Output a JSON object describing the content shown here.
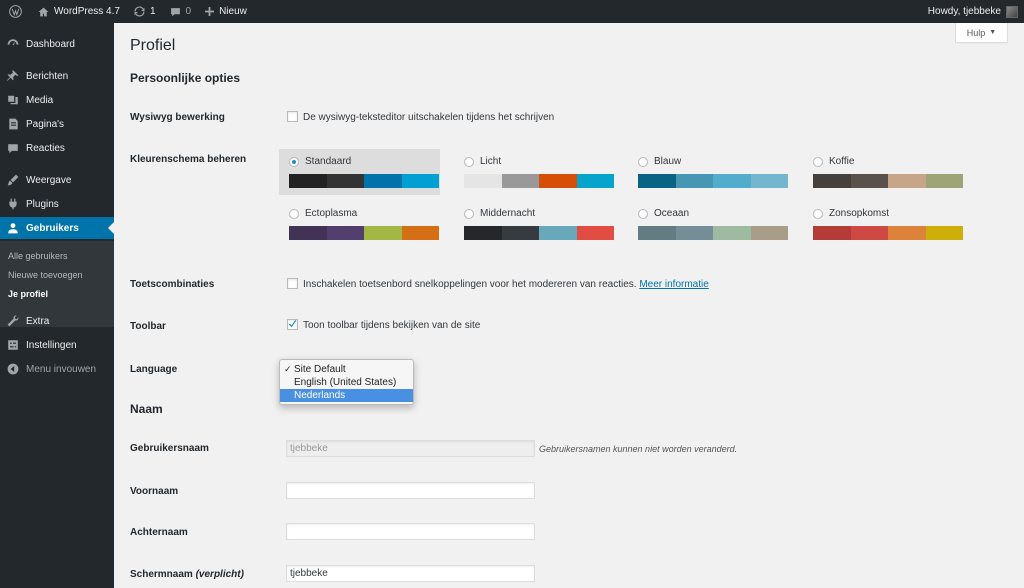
{
  "adminbar": {
    "site_name": "WordPress 4.7",
    "updates_count": "1",
    "comments_count": "0",
    "new_label": "Nieuw",
    "howdy": "Howdy, tjebbeke"
  },
  "sidebar": {
    "items": [
      {
        "label": "Dashboard",
        "icon": "dashboard-icon"
      },
      {
        "label": "Berichten",
        "icon": "pushpin-icon"
      },
      {
        "label": "Media",
        "icon": "media-icon"
      },
      {
        "label": "Pagina's",
        "icon": "page-icon"
      },
      {
        "label": "Reacties",
        "icon": "comment-icon"
      },
      {
        "label": "Weergave",
        "icon": "appearance-icon"
      },
      {
        "label": "Plugins",
        "icon": "plugin-icon"
      },
      {
        "label": "Gebruikers",
        "icon": "users-icon"
      },
      {
        "label": "Extra",
        "icon": "tools-icon"
      },
      {
        "label": "Instellingen",
        "icon": "settings-icon"
      }
    ],
    "submenu": [
      "Alle gebruikers",
      "Nieuwe toevoegen",
      "Je profiel"
    ],
    "collapse": "Menu invouwen"
  },
  "page": {
    "title": "Profiel",
    "help": "Hulp",
    "personal_options": "Persoonlijke opties",
    "wysiwyg_label": "Wysiwyg bewerking",
    "wysiwyg_text": "De wysiwyg-teksteditor uitschakelen tijdens het schrijven",
    "color_label": "Kleurenschema beheren",
    "shortcuts_label": "Toetscombinaties",
    "shortcuts_text": "Inschakelen toetsenbord snelkoppelingen voor het modereren van reacties.",
    "shortcuts_link": "Meer informatie",
    "toolbar_label": "Toolbar",
    "toolbar_text": "Toon toolbar tijdens bekijken van de site",
    "language_label": "Language",
    "name_section": "Naam",
    "username_label": "Gebruikersnaam",
    "username_value": "tjebbeke",
    "username_desc": "Gebruikersnamen kunnen niet worden veranderd.",
    "firstname_label": "Voornaam",
    "lastname_label": "Achternaam",
    "nickname_label": "Schermnaam",
    "nickname_required": "(verplicht)",
    "nickname_value": "tjebbeke"
  },
  "schemes": [
    {
      "name": "Standaard",
      "selected": true,
      "colors": [
        "#222222",
        "#333333",
        "#0073aa",
        "#00a0d2"
      ]
    },
    {
      "name": "Licht",
      "selected": false,
      "colors": [
        "#e5e5e5",
        "#999999",
        "#d64e07",
        "#04a4cc"
      ]
    },
    {
      "name": "Blauw",
      "selected": false,
      "colors": [
        "#096484",
        "#4796b3",
        "#52accc",
        "#74b6ce"
      ]
    },
    {
      "name": "Koffie",
      "selected": false,
      "colors": [
        "#46403c",
        "#59524c",
        "#c7a589",
        "#9ea476"
      ]
    },
    {
      "name": "Ectoplasma",
      "selected": false,
      "colors": [
        "#413256",
        "#523f6d",
        "#a3b745",
        "#d46f15"
      ]
    },
    {
      "name": "Middernacht",
      "selected": false,
      "colors": [
        "#25282b",
        "#363b3f",
        "#69a8bb",
        "#e14d43"
      ]
    },
    {
      "name": "Oceaan",
      "selected": false,
      "colors": [
        "#627c83",
        "#738e96",
        "#9ebaa0",
        "#aa9d88"
      ]
    },
    {
      "name": "Zonsopkomst",
      "selected": false,
      "colors": [
        "#b43c38",
        "#cf4944",
        "#dd823b",
        "#ccaf0b"
      ]
    }
  ],
  "language": {
    "options": [
      "Site Default",
      "English (United States)",
      "Nederlands"
    ],
    "checked": "Site Default",
    "highlighted": "Nederlands"
  },
  "checkboxes": {
    "wysiwyg": false,
    "shortcuts": false,
    "toolbar": true
  }
}
